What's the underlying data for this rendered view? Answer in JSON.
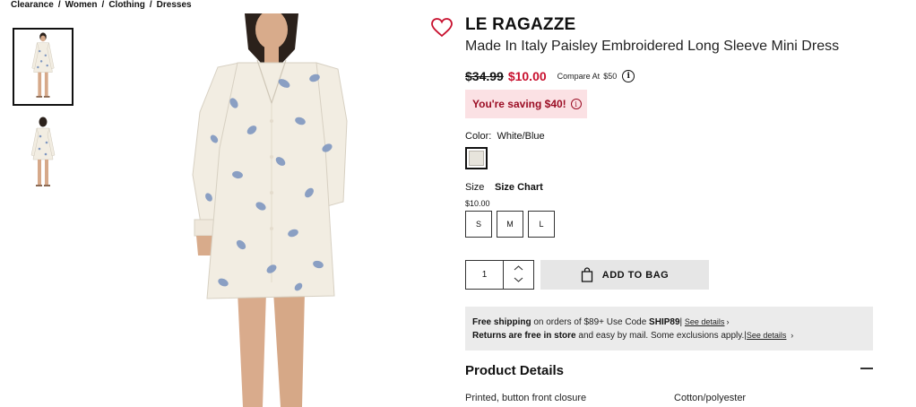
{
  "breadcrumb": [
    "Clearance",
    "Women",
    "Clothing",
    "Dresses"
  ],
  "breadcrumb_separator": "/",
  "product": {
    "brand": "LE RAGAZZE",
    "title": "Made In Italy Paisley Embroidered Long Sleeve Mini Dress",
    "original_price": "$34.99",
    "sale_price": "$10.00",
    "compare_label": "Compare At",
    "compare_value": "$50",
    "saving_text": "You're saving $40!",
    "color_label": "Color:",
    "color_value": "White/Blue",
    "size_label": "Size",
    "size_chart": "Size Chart",
    "size_price": "$10.00",
    "sizes": [
      "S",
      "M",
      "L"
    ],
    "quantity": "1",
    "add_to_bag": "ADD TO BAG"
  },
  "shipping": {
    "line1_bold": "Free shipping",
    "line1_text": " on orders of $89+ Use Code ",
    "line1_code": "SHIP89",
    "line1_sep": "|",
    "line2_bold": "Returns are free in store",
    "line2_text": " and easy by mail. Some exclusions apply.",
    "line2_sep": "|",
    "see_details": "See details",
    "chevron": "›"
  },
  "details": {
    "heading": "Product Details",
    "line1": "Printed, button front closure",
    "line2": "Cotton/polyester"
  },
  "icons": {
    "wishlist": "heart-outline-icon",
    "info": "info-icon",
    "bag": "shopping-bag-icon",
    "qty_up": "chevron-up-icon",
    "qty_down": "chevron-down-icon",
    "collapse": "minus-icon"
  },
  "colors": {
    "sale_red": "#c8102e",
    "saving_bg": "#fbe1e4",
    "saving_text": "#9b0d24",
    "button_gray": "#e6e6e6",
    "ship_bg": "#ebebeb",
    "dress": "#f2ede2",
    "paisley": "#7f97c0"
  }
}
